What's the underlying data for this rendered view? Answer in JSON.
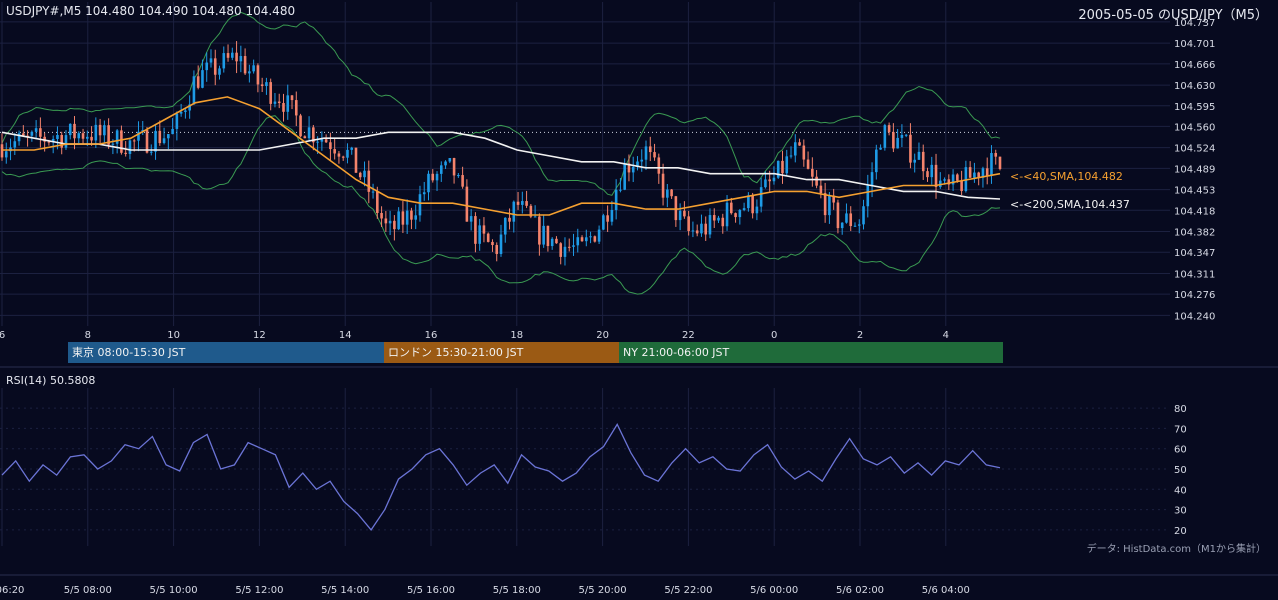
{
  "header": {
    "symbol_line": "USDJPY#,M5 104.480 104.490 104.480 104.480",
    "title_right": "2005-05-05 のUSD/JPY（M5）"
  },
  "colors": {
    "background": "#070a1f",
    "grid": "#1c2140",
    "bull": "#1e9be6",
    "bear": "#f4836c",
    "sma40": "#f5a030",
    "sma200": "#f2f2f2",
    "bollinger": "#3a9a52",
    "rsi": "#6b74d6",
    "session_tokyo": "#1f5a8c",
    "session_london": "#9b5a14",
    "session_ny": "#1f6b3a"
  },
  "chart_data": [
    {
      "type": "candlestick",
      "title": "USDJPY#,M5 104.480 104.490 104.480 104.480",
      "ylim": [
        104.222,
        104.747
      ],
      "yticks": [
        "104.737",
        "104.701",
        "104.666",
        "104.630",
        "104.595",
        "104.560",
        "104.524",
        "104.489",
        "104.453",
        "104.418",
        "104.382",
        "104.347",
        "104.311",
        "104.276",
        "104.240"
      ],
      "xticks": [
        "6",
        "8",
        "10",
        "12",
        "14",
        "16",
        "18",
        "20",
        "22",
        "0",
        "2",
        "4"
      ],
      "dotted_level": 104.55,
      "close_path": [
        [
          0,
          104.52
        ],
        [
          2,
          104.54
        ],
        [
          4,
          104.52
        ],
        [
          6,
          104.53
        ],
        [
          8,
          104.55
        ],
        [
          9,
          104.53
        ],
        [
          10,
          104.55
        ],
        [
          10.5,
          104.64
        ],
        [
          11,
          104.66
        ],
        [
          11.5,
          104.68
        ],
        [
          12,
          104.63
        ],
        [
          12.5,
          104.61
        ],
        [
          13,
          104.56
        ],
        [
          13.5,
          104.54
        ],
        [
          14,
          104.52
        ],
        [
          14.5,
          104.46
        ],
        [
          15,
          104.38
        ],
        [
          15.5,
          104.41
        ],
        [
          16,
          104.47
        ],
        [
          16.5,
          104.49
        ],
        [
          17,
          104.38
        ],
        [
          17.5,
          104.35
        ],
        [
          18,
          104.43
        ],
        [
          18.5,
          104.38
        ],
        [
          19,
          104.36
        ],
        [
          19.5,
          104.35
        ],
        [
          20,
          104.4
        ],
        [
          20.5,
          104.49
        ],
        [
          21,
          104.52
        ],
        [
          21.5,
          104.44
        ],
        [
          22,
          104.38
        ],
        [
          22.5,
          104.39
        ],
        [
          23,
          104.42
        ],
        [
          23.5,
          104.43
        ],
        [
          0,
          104.47
        ],
        [
          0.5,
          104.52
        ],
        [
          1,
          104.45
        ],
        [
          1.5,
          104.4
        ],
        [
          2,
          104.4
        ],
        [
          2.5,
          104.55
        ],
        [
          3,
          104.53
        ],
        [
          3.5,
          104.5
        ],
        [
          4,
          104.45
        ],
        [
          4.5,
          104.47
        ],
        [
          5,
          104.5
        ],
        [
          5.5,
          104.48
        ]
      ],
      "series": [
        {
          "name": "40,SMA",
          "last_value": 104.482,
          "label": "<-<40,SMA,104.482",
          "values": [
            104.52,
            104.52,
            104.53,
            104.53,
            104.54,
            104.57,
            104.6,
            104.61,
            104.59,
            104.55,
            104.51,
            104.47,
            104.44,
            104.43,
            104.43,
            104.42,
            104.41,
            104.41,
            104.43,
            104.43,
            104.42,
            104.42,
            104.43,
            104.44,
            104.45,
            104.45,
            104.44,
            104.45,
            104.46,
            104.46,
            104.47,
            104.48
          ]
        },
        {
          "name": "200,SMA",
          "last_value": 104.437,
          "label": "<-<200,SMA,104.437",
          "values": [
            104.55,
            104.54,
            104.53,
            104.53,
            104.52,
            104.52,
            104.52,
            104.52,
            104.52,
            104.53,
            104.54,
            104.54,
            104.55,
            104.55,
            104.55,
            104.54,
            104.52,
            104.51,
            104.5,
            104.5,
            104.49,
            104.49,
            104.48,
            104.48,
            104.48,
            104.47,
            104.47,
            104.46,
            104.45,
            104.45,
            104.44,
            104.437
          ]
        }
      ]
    },
    {
      "type": "line",
      "title": "RSI(14) 50.5808",
      "ylim": [
        15,
        85
      ],
      "yticks": [
        "80",
        "70",
        "60",
        "50",
        "40",
        "30",
        "20"
      ],
      "series": [
        {
          "name": "RSI(14)",
          "last_value": 50.5808,
          "values": [
            47,
            54,
            44,
            52,
            47,
            56,
            57,
            50,
            54,
            62,
            60,
            66,
            52,
            49,
            63,
            67,
            50,
            52,
            63,
            60,
            57,
            41,
            48,
            40,
            44,
            34,
            28,
            20,
            30,
            45,
            50,
            57,
            60,
            52,
            42,
            48,
            52,
            43,
            57,
            51,
            49,
            44,
            48,
            56,
            61,
            72,
            58,
            47,
            44,
            53,
            60,
            53,
            56,
            50,
            49,
            57,
            62,
            51,
            45,
            49,
            44,
            55,
            65,
            55,
            52,
            56,
            48,
            53,
            47,
            54,
            52,
            59,
            52,
            50.58
          ]
        }
      ]
    }
  ],
  "sessions": [
    {
      "label": "東京 08:00-15:30 JST"
    },
    {
      "label": "ロンドン 15:30-21:00 JST"
    },
    {
      "label": "NY 21:00-06:00 JST"
    }
  ],
  "rsi": {
    "label": "RSI(14) 50.5808"
  },
  "bottom_axis": [
    "06:20",
    "5/5 08:00",
    "5/5 10:00",
    "5/5 12:00",
    "5/5 14:00",
    "5/5 16:00",
    "5/5 18:00",
    "5/5 20:00",
    "5/5 22:00",
    "5/6 00:00",
    "5/6 02:00",
    "5/6 04:00"
  ],
  "source_note": "データ: HistData.com（M1から集計）"
}
